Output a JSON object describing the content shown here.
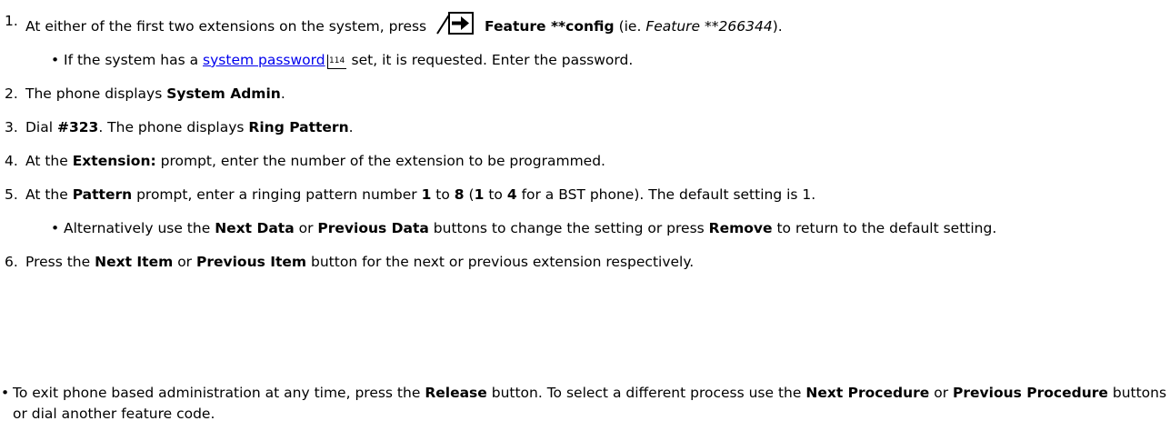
{
  "steps": [
    {
      "number": "1.",
      "pre": "At either of the first two extensions on the system, press",
      "bold": "Feature **config",
      "mid": "(ie.",
      "italic": "Feature **266344",
      "post": ").",
      "sub": {
        "pre": "If the system has a",
        "link": "system password",
        "ref": "114",
        "post": "set, it is requested. Enter the password."
      }
    },
    {
      "number": "2.",
      "pre": "The phone displays",
      "bold": "System Admin",
      "post": "."
    },
    {
      "number": "3.",
      "pre": "Dial",
      "bold1": "#323",
      "mid": ". The phone displays",
      "bold2": "Ring Pattern",
      "post": "."
    },
    {
      "number": "4.",
      "pre": "At the",
      "bold": "Extension:",
      "post": "prompt, enter the number of the extension to be programmed."
    },
    {
      "number": "5.",
      "pre": "At the",
      "bold1": "Pattern",
      "t1": "prompt, enter a ringing pattern number",
      "bold2": "1",
      "t2": "to",
      "bold3": "8",
      "t3": "(",
      "bold4": "1",
      "t4": "to",
      "bold5": "4",
      "t5": "for a BST phone). The default setting is 1.",
      "sub": {
        "pre": "Alternatively use the",
        "bold1": "Next Data",
        "t1": "or",
        "bold2": "Previous Data",
        "t2": "buttons to change the setting or press",
        "bold3": "Remove",
        "t3": "to return to the default setting."
      }
    },
    {
      "number": "6.",
      "pre": "Press the",
      "bold1": "Next Item",
      "t1": "or",
      "bold2": "Previous Item",
      "post": "button for the next or previous extension respectively."
    }
  ],
  "final": {
    "pre": "To exit phone based administration at any time, press the",
    "bold1": "Release",
    "t1": "button. To select a different process use the",
    "bold2": "Next Procedure",
    "t2": "or",
    "bold3": "Previous Procedure",
    "post": "buttons or dial another feature code."
  }
}
